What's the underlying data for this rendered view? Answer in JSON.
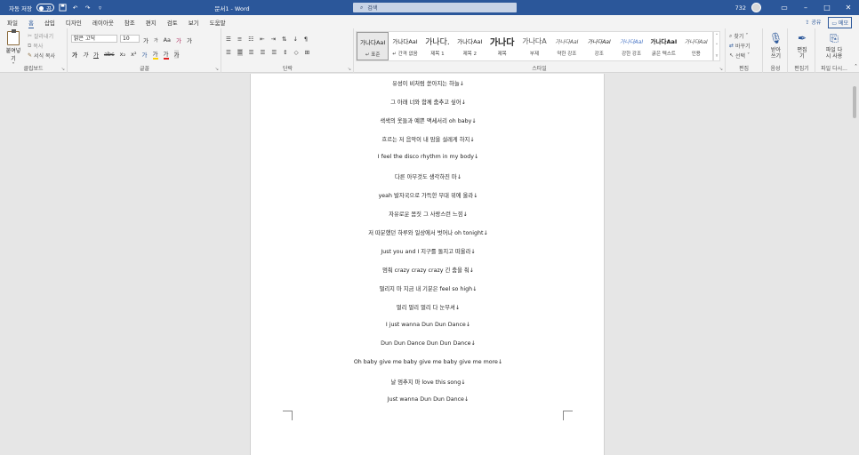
{
  "titlebar": {
    "autosave_label": "자동 저장",
    "autosave_state": "끔",
    "doc_title": "문서1 - Word",
    "search_placeholder": "검색",
    "account": "732",
    "icons": [
      "save-icon",
      "undo-icon",
      "redo-icon",
      "customize-icon"
    ]
  },
  "menu": {
    "tabs": [
      "파일",
      "홈",
      "삽입",
      "디자인",
      "레이아웃",
      "참조",
      "편지",
      "검토",
      "보기",
      "도움말"
    ],
    "active_tab": "홈",
    "share": "공유",
    "memo": "메모"
  },
  "ribbon": {
    "clipboard": {
      "paste": "붙여넣기",
      "cut": "잘라내기",
      "copy": "복사",
      "format_painter": "서식 복사",
      "label": "클립보드"
    },
    "font": {
      "font_name": "맑은 고딕",
      "font_size": "10",
      "row1": [
        "가",
        "가",
        "Aa",
        "가",
        "가"
      ],
      "row2": [
        "가",
        "가",
        "가",
        "abc",
        "x₂",
        "x²",
        "가",
        "가",
        "가",
        "가"
      ],
      "label": "글꼴"
    },
    "paragraph": {
      "label": "단락"
    },
    "styles": {
      "items": [
        {
          "sample": "가나다AaI",
          "name": "↵ 표준"
        },
        {
          "sample": "가나다AaI",
          "name": "↵ 간격 없음"
        },
        {
          "sample": "가나다.",
          "name": "제목 1"
        },
        {
          "sample": "가나다AaI",
          "name": "제목 2"
        },
        {
          "sample": "가나다",
          "name": "제목"
        },
        {
          "sample": "가나다A",
          "name": "부제"
        },
        {
          "sample": "가나다AaI",
          "name": "약한 강조"
        },
        {
          "sample": "가나다AaI",
          "name": "강조"
        },
        {
          "sample": "가나다AaI",
          "name": "강한 강조"
        },
        {
          "sample": "가나다AaI",
          "name": "굵은 텍스트"
        },
        {
          "sample": "가나다AaI",
          "name": "인용"
        }
      ],
      "label": "스타일"
    },
    "editing": {
      "find": "찾기",
      "replace": "바꾸기",
      "select": "선택",
      "label": "편집"
    },
    "voice": {
      "dictate": "받아쓰기",
      "label": "음성"
    },
    "editor": {
      "name": "편집기",
      "label": "편집기"
    },
    "reuse": {
      "name": "파일 다시 사용",
      "label": "파일 다시..."
    }
  },
  "document": {
    "lines": [
      "유성이 비처럼 쏟아지는 하늘↓",
      "그 아래 너와 함께 춤추고 싶어↓",
      "색색의 옷들과 예쁜 액세서리 oh baby↓",
      "흐르는 저 음악이 내 맘을 설레게 하지↓",
      "I feel the disco rhythm in my body↓",
      "다른 아무것도 생각하진 마↓",
      "yeah 발자국으로 가득한 무대 위에 올라↓",
      "자유로운 몸짓 그 사랑스런 느낌↓",
      "저 따분했던 하루와 일상에서 벗어나 oh tonight↓",
      "Just you and I 지구를 돌지고 떠올라↓",
      "멈춰 crazy crazy crazy 긴 춤을 춰↓",
      "떨리지 마 지금 내 기분은 feel so high↓",
      "멀리 멀리 멀리 다 눈부셔↓",
      "I just wanna Dun Dun Dance↓",
      "Dun Dun Dance Dun Dun Dance↓",
      "Oh baby give me baby give me baby give me more↓",
      "날 멈추지 마 love this song↓",
      "Just wanna Dun Dun Dance↓"
    ]
  }
}
